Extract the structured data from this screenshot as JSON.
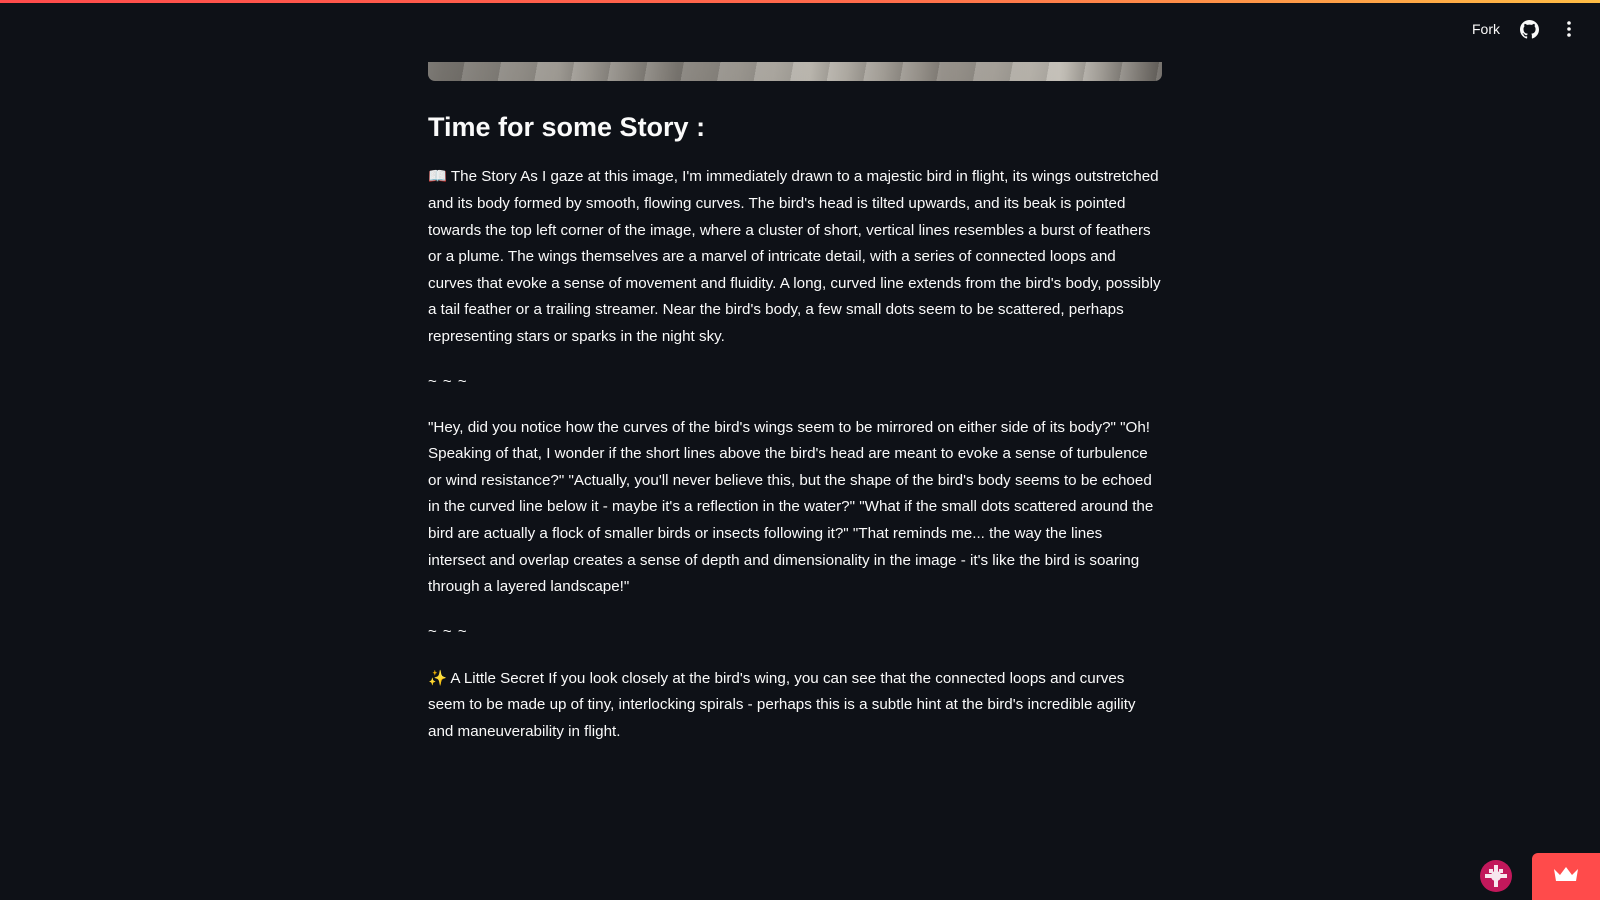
{
  "header": {
    "fork_label": "Fork",
    "accent_gradient": [
      "#ff4b4b",
      "#ffbd45"
    ],
    "icons": [
      "github-icon",
      "more-vertical-icon"
    ]
  },
  "story": {
    "heading": "Time for some Story :",
    "section1": {
      "icon": "📖",
      "text": "The Story As I gaze at this image, I'm immediately drawn to a majestic bird in flight, its wings outstretched and its body formed by smooth, flowing curves. The bird's head is tilted upwards, and its beak is pointed towards the top left corner of the image, where a cluster of short, vertical lines resembles a burst of feathers or a plume. The wings themselves are a marvel of intricate detail, with a series of connected loops and curves that evoke a sense of movement and fluidity. A long, curved line extends from the bird's body, possibly a tail feather or a trailing streamer. Near the bird's body, a few small dots seem to be scattered, perhaps representing stars or sparks in the night sky."
    },
    "separator1": "~ ~ ~",
    "section2": {
      "text": "\"Hey, did you notice how the curves of the bird's wings seem to be mirrored on either side of its body?\" \"Oh! Speaking of that, I wonder if the short lines above the bird's head are meant to evoke a sense of turbulence or wind resistance?\" \"Actually, you'll never believe this, but the shape of the bird's body seems to be echoed in the curved line below it - maybe it's a reflection in the water?\" \"What if the small dots scattered around the bird are actually a flock of smaller birds or insects following it?\" \"That reminds me... the way the lines intersect and overlap creates a sense of depth and dimensionality in the image - it's like the bird is soaring through a layered landscape!\""
    },
    "separator2": "~ ~ ~",
    "section3": {
      "icon": "✨",
      "text": "A Little Secret If you look closely at the bird's wing, you can see that the connected loops and curves seem to be made up of tiny, interlocking spirals - perhaps this is a subtle hint at the bird's incredible agility and maneuverability in flight."
    }
  },
  "footer": {
    "avatar_icon": "user-avatar-icon",
    "crown_button_color": "#ff4b4b",
    "crown_icon": "crown-icon"
  }
}
